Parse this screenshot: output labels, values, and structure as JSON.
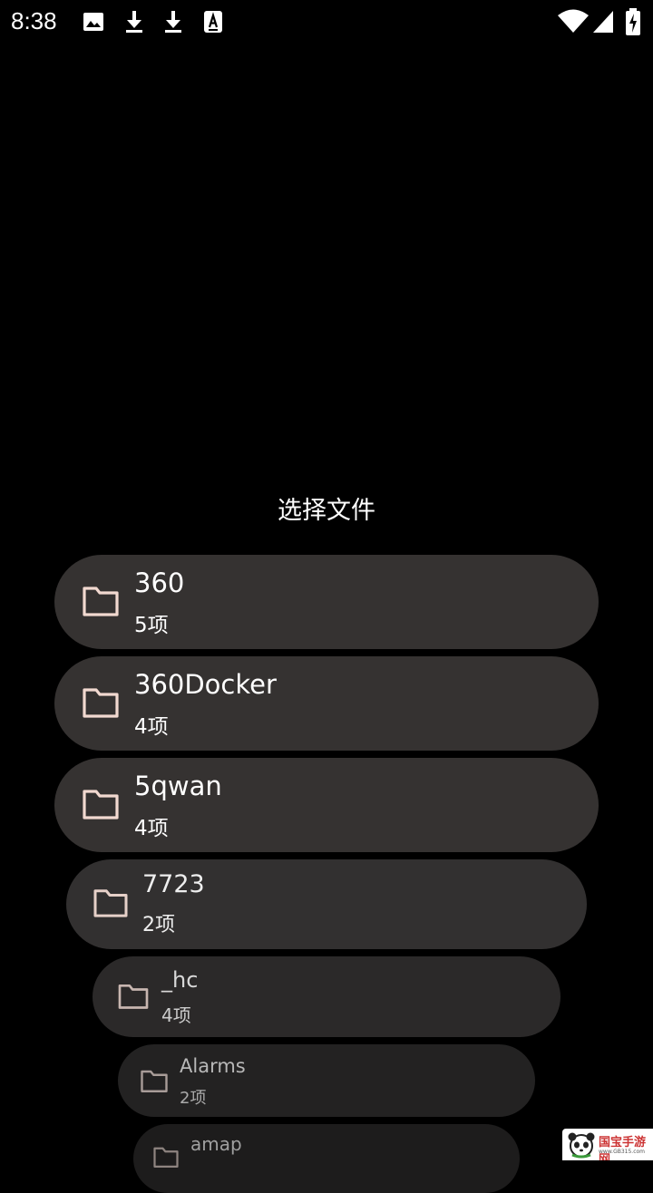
{
  "status_bar": {
    "time": "8:38",
    "notification_icons": [
      "image-icon",
      "download-icon",
      "download-icon",
      "accessibility-app-icon"
    ],
    "system_icons": [
      "wifi-icon",
      "signal-icon",
      "battery-charging-icon"
    ]
  },
  "dialog": {
    "title": "选择文件",
    "items": [
      {
        "name": "360",
        "count": "5项",
        "icon": "folder-icon"
      },
      {
        "name": "360Docker",
        "count": "4项",
        "icon": "folder-icon"
      },
      {
        "name": "5qwan",
        "count": "4项",
        "icon": "folder-icon"
      },
      {
        "name": "7723",
        "count": "2项",
        "icon": "folder-icon"
      },
      {
        "name": "_hc",
        "count": "4项",
        "icon": "folder-icon"
      },
      {
        "name": "Alarms",
        "count": "2项",
        "icon": "folder-icon"
      },
      {
        "name": "amap",
        "count": "",
        "icon": "folder-icon"
      }
    ]
  },
  "watermark": {
    "text": "国宝手游网",
    "subtext": "www.GB315.com"
  },
  "colors": {
    "background": "#000000",
    "item_bg": "#353231",
    "folder_icon": "#f2d9d0"
  }
}
